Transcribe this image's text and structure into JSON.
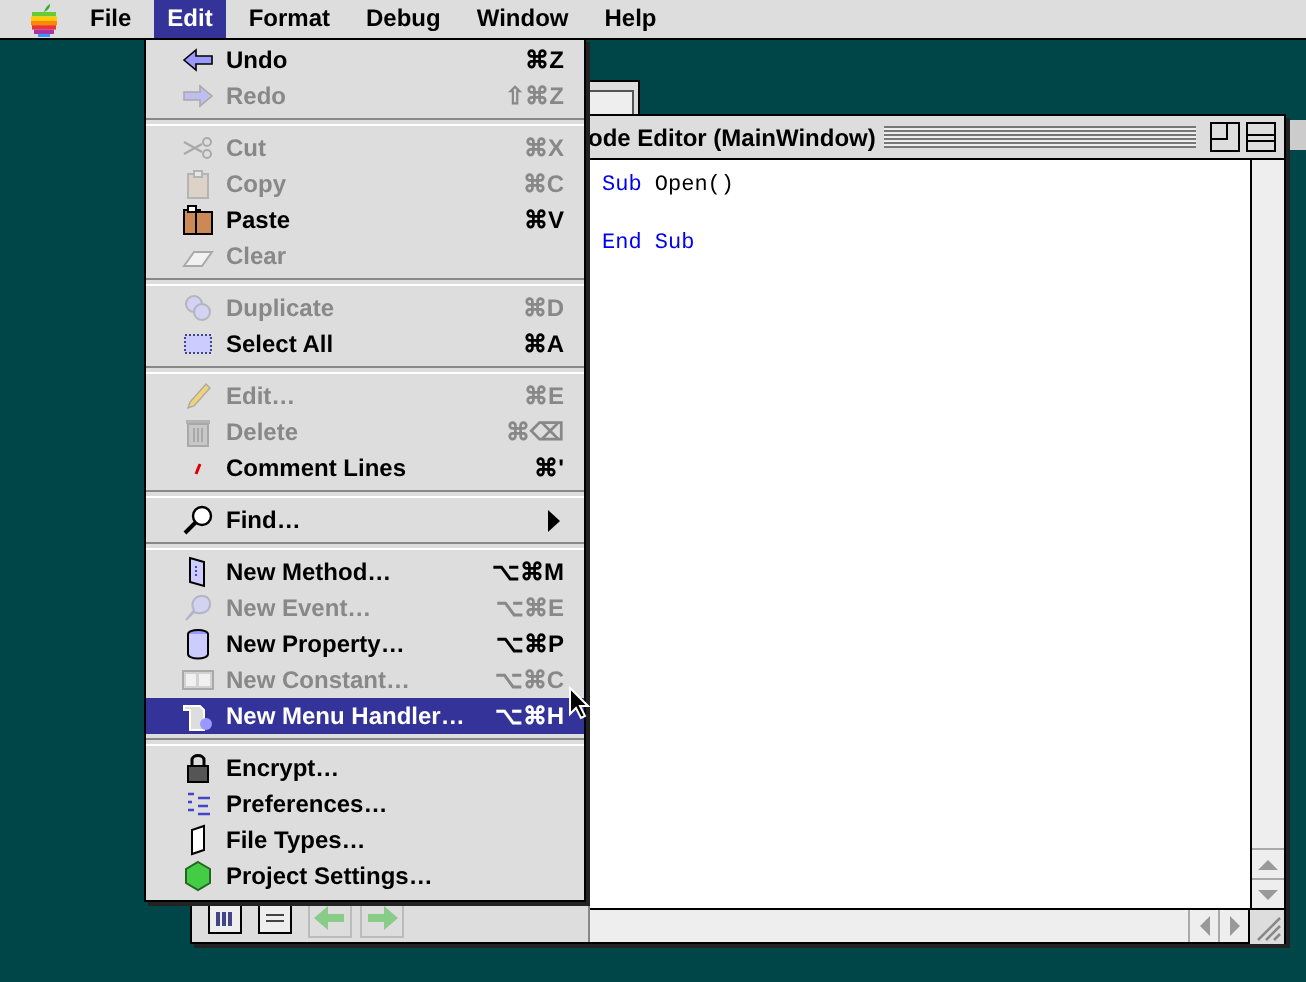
{
  "menubar": {
    "items": [
      {
        "label": "File",
        "selected": false
      },
      {
        "label": "Edit",
        "selected": true
      },
      {
        "label": "Format",
        "selected": false
      },
      {
        "label": "Debug",
        "selected": false
      },
      {
        "label": "Window",
        "selected": false
      },
      {
        "label": "Help",
        "selected": false
      }
    ]
  },
  "menu": {
    "groups": [
      [
        {
          "label": "Undo",
          "shortcut": "⌘Z",
          "disabled": false,
          "selected": false,
          "submenu": false
        },
        {
          "label": "Redo",
          "shortcut": "⇧⌘Z",
          "disabled": true,
          "selected": false,
          "submenu": false
        }
      ],
      [
        {
          "label": "Cut",
          "shortcut": "⌘X",
          "disabled": true,
          "selected": false,
          "submenu": false
        },
        {
          "label": "Copy",
          "shortcut": "⌘C",
          "disabled": true,
          "selected": false,
          "submenu": false
        },
        {
          "label": "Paste",
          "shortcut": "⌘V",
          "disabled": false,
          "selected": false,
          "submenu": false
        },
        {
          "label": "Clear",
          "disabled": true,
          "selected": false,
          "submenu": false
        }
      ],
      [
        {
          "label": "Duplicate",
          "shortcut": "⌘D",
          "disabled": true,
          "selected": false,
          "submenu": false
        },
        {
          "label": "Select All",
          "shortcut": "⌘A",
          "disabled": false,
          "selected": false,
          "submenu": false
        }
      ],
      [
        {
          "label": "Edit…",
          "shortcut": "⌘E",
          "disabled": true,
          "selected": false,
          "submenu": false
        },
        {
          "label": "Delete",
          "shortcut": "⌘⌫",
          "disabled": true,
          "selected": false,
          "submenu": false
        },
        {
          "label": "Comment Lines",
          "shortcut": "⌘'",
          "disabled": false,
          "selected": false,
          "submenu": false
        }
      ],
      [
        {
          "label": "Find…",
          "disabled": false,
          "selected": false,
          "submenu": true
        }
      ],
      [
        {
          "label": "New Method…",
          "shortcut": "⌥⌘M",
          "disabled": false,
          "selected": false,
          "submenu": false
        },
        {
          "label": "New Event…",
          "shortcut": "⌥⌘E",
          "disabled": true,
          "selected": false,
          "submenu": false
        },
        {
          "label": "New Property…",
          "shortcut": "⌥⌘P",
          "disabled": false,
          "selected": false,
          "submenu": false
        },
        {
          "label": "New Constant…",
          "shortcut": "⌥⌘C",
          "disabled": true,
          "selected": false,
          "submenu": false
        },
        {
          "label": "New Menu Handler…",
          "shortcut": "⌥⌘H",
          "disabled": false,
          "selected": true,
          "submenu": false
        }
      ],
      [
        {
          "label": "Encrypt…",
          "disabled": false,
          "selected": false,
          "submenu": false
        },
        {
          "label": "Preferences…",
          "disabled": false,
          "selected": false,
          "submenu": false
        },
        {
          "label": "File Types…",
          "disabled": false,
          "selected": false,
          "submenu": false
        },
        {
          "label": "Project Settings…",
          "disabled": false,
          "selected": false,
          "submenu": false
        }
      ]
    ]
  },
  "editor": {
    "title": "ode Editor (MainWindow)",
    "code": [
      {
        "tokens": [
          {
            "text": "Sub",
            "kind": "keyword"
          },
          {
            "text": "Open()",
            "kind": "plain"
          }
        ]
      },
      {
        "tokens": [
          {
            "text": "End Sub",
            "kind": "keyword"
          }
        ]
      }
    ]
  }
}
